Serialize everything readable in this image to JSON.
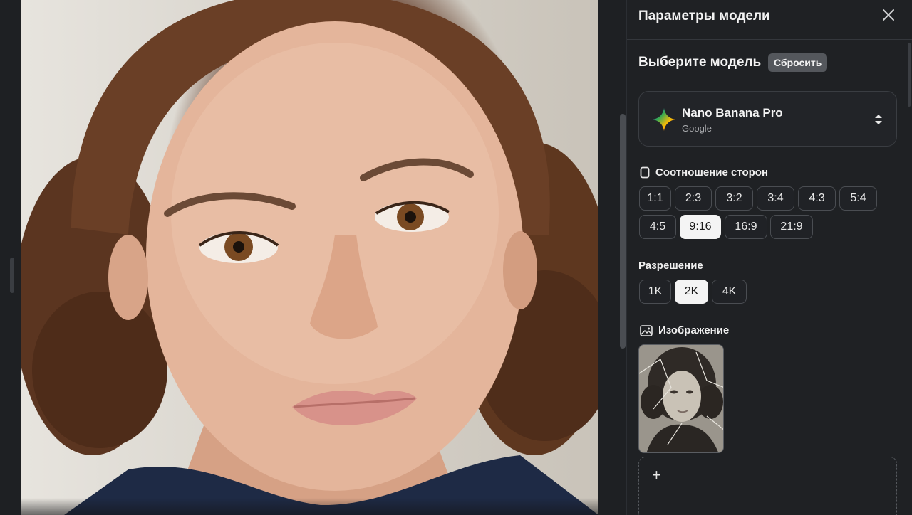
{
  "panel": {
    "title": "Параметры модели",
    "close_icon": "close-icon"
  },
  "model_section": {
    "title": "Выберите модель",
    "reset_label": "Сбросить",
    "model": {
      "name": "Nano Banana Pro",
      "vendor": "Google",
      "icon": "gemini-sparkle-icon",
      "chevron_icon": "sort-chevrons-icon"
    }
  },
  "aspect_ratio": {
    "label": "Соотношение сторон",
    "icon": "portrait-rectangle-icon",
    "options": [
      "1:1",
      "2:3",
      "3:2",
      "3:4",
      "4:3",
      "5:4",
      "4:5",
      "9:16",
      "16:9",
      "21:9"
    ],
    "selected": "9:16"
  },
  "resolution": {
    "label": "Разрешение",
    "options": [
      "1K",
      "2K",
      "4K"
    ],
    "selected": "2K"
  },
  "image_section": {
    "label": "Изображение",
    "icon": "image-icon",
    "thumbnail_icon": "vintage-portrait-photo",
    "add_icon": "plus-icon",
    "add_label": "+"
  },
  "colors": {
    "panel_bg": "#1f2124",
    "chip_border": "#4a4d52",
    "chip_selected_bg": "#f4f4f4",
    "reset_bg": "#54575c"
  }
}
